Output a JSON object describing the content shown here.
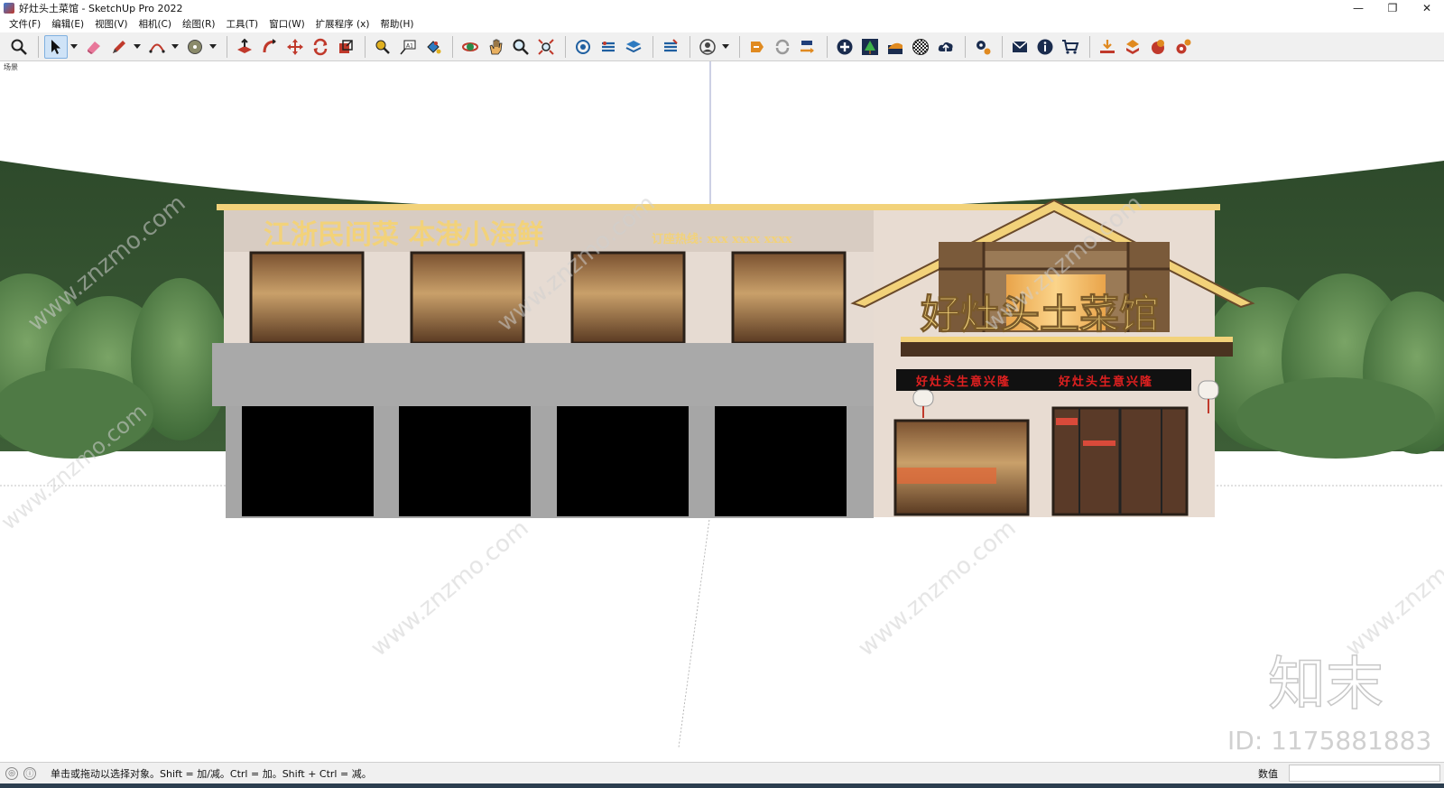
{
  "window": {
    "title": "好灶头土菜馆 - SketchUp Pro 2022",
    "minimize": "—",
    "maximize": "❐",
    "close": "✕"
  },
  "menu": [
    "文件(F)",
    "编辑(E)",
    "视图(V)",
    "相机(C)",
    "绘图(R)",
    "工具(T)",
    "窗口(W)",
    "扩展程序 (x)",
    "帮助(H)"
  ],
  "scene_tab": "场景",
  "model": {
    "banner_text": "江浙民间菜  本港小海鲜",
    "hotline_text": "订座热线: xxx xxxx xxxx",
    "restaurant_sign": "好灶头土菜馆",
    "sub_sign_left": "好灶头生意兴隆",
    "sub_sign_right": "好灶头生意兴隆"
  },
  "watermark": {
    "site": "www.znzmo.com",
    "brand_logo": "知末",
    "id_text": "ID: 1175881883"
  },
  "status": {
    "hint": "单击或拖动以选择对象。Shift = 加/减。Ctrl = 加。Shift + Ctrl = 减。",
    "measurements_label": "数值"
  },
  "colors": {
    "signage_gold": "#f2d27a",
    "sign_red": "#e02020",
    "hill_green": "#2f4a2c",
    "facade": "#e8dcd2"
  }
}
